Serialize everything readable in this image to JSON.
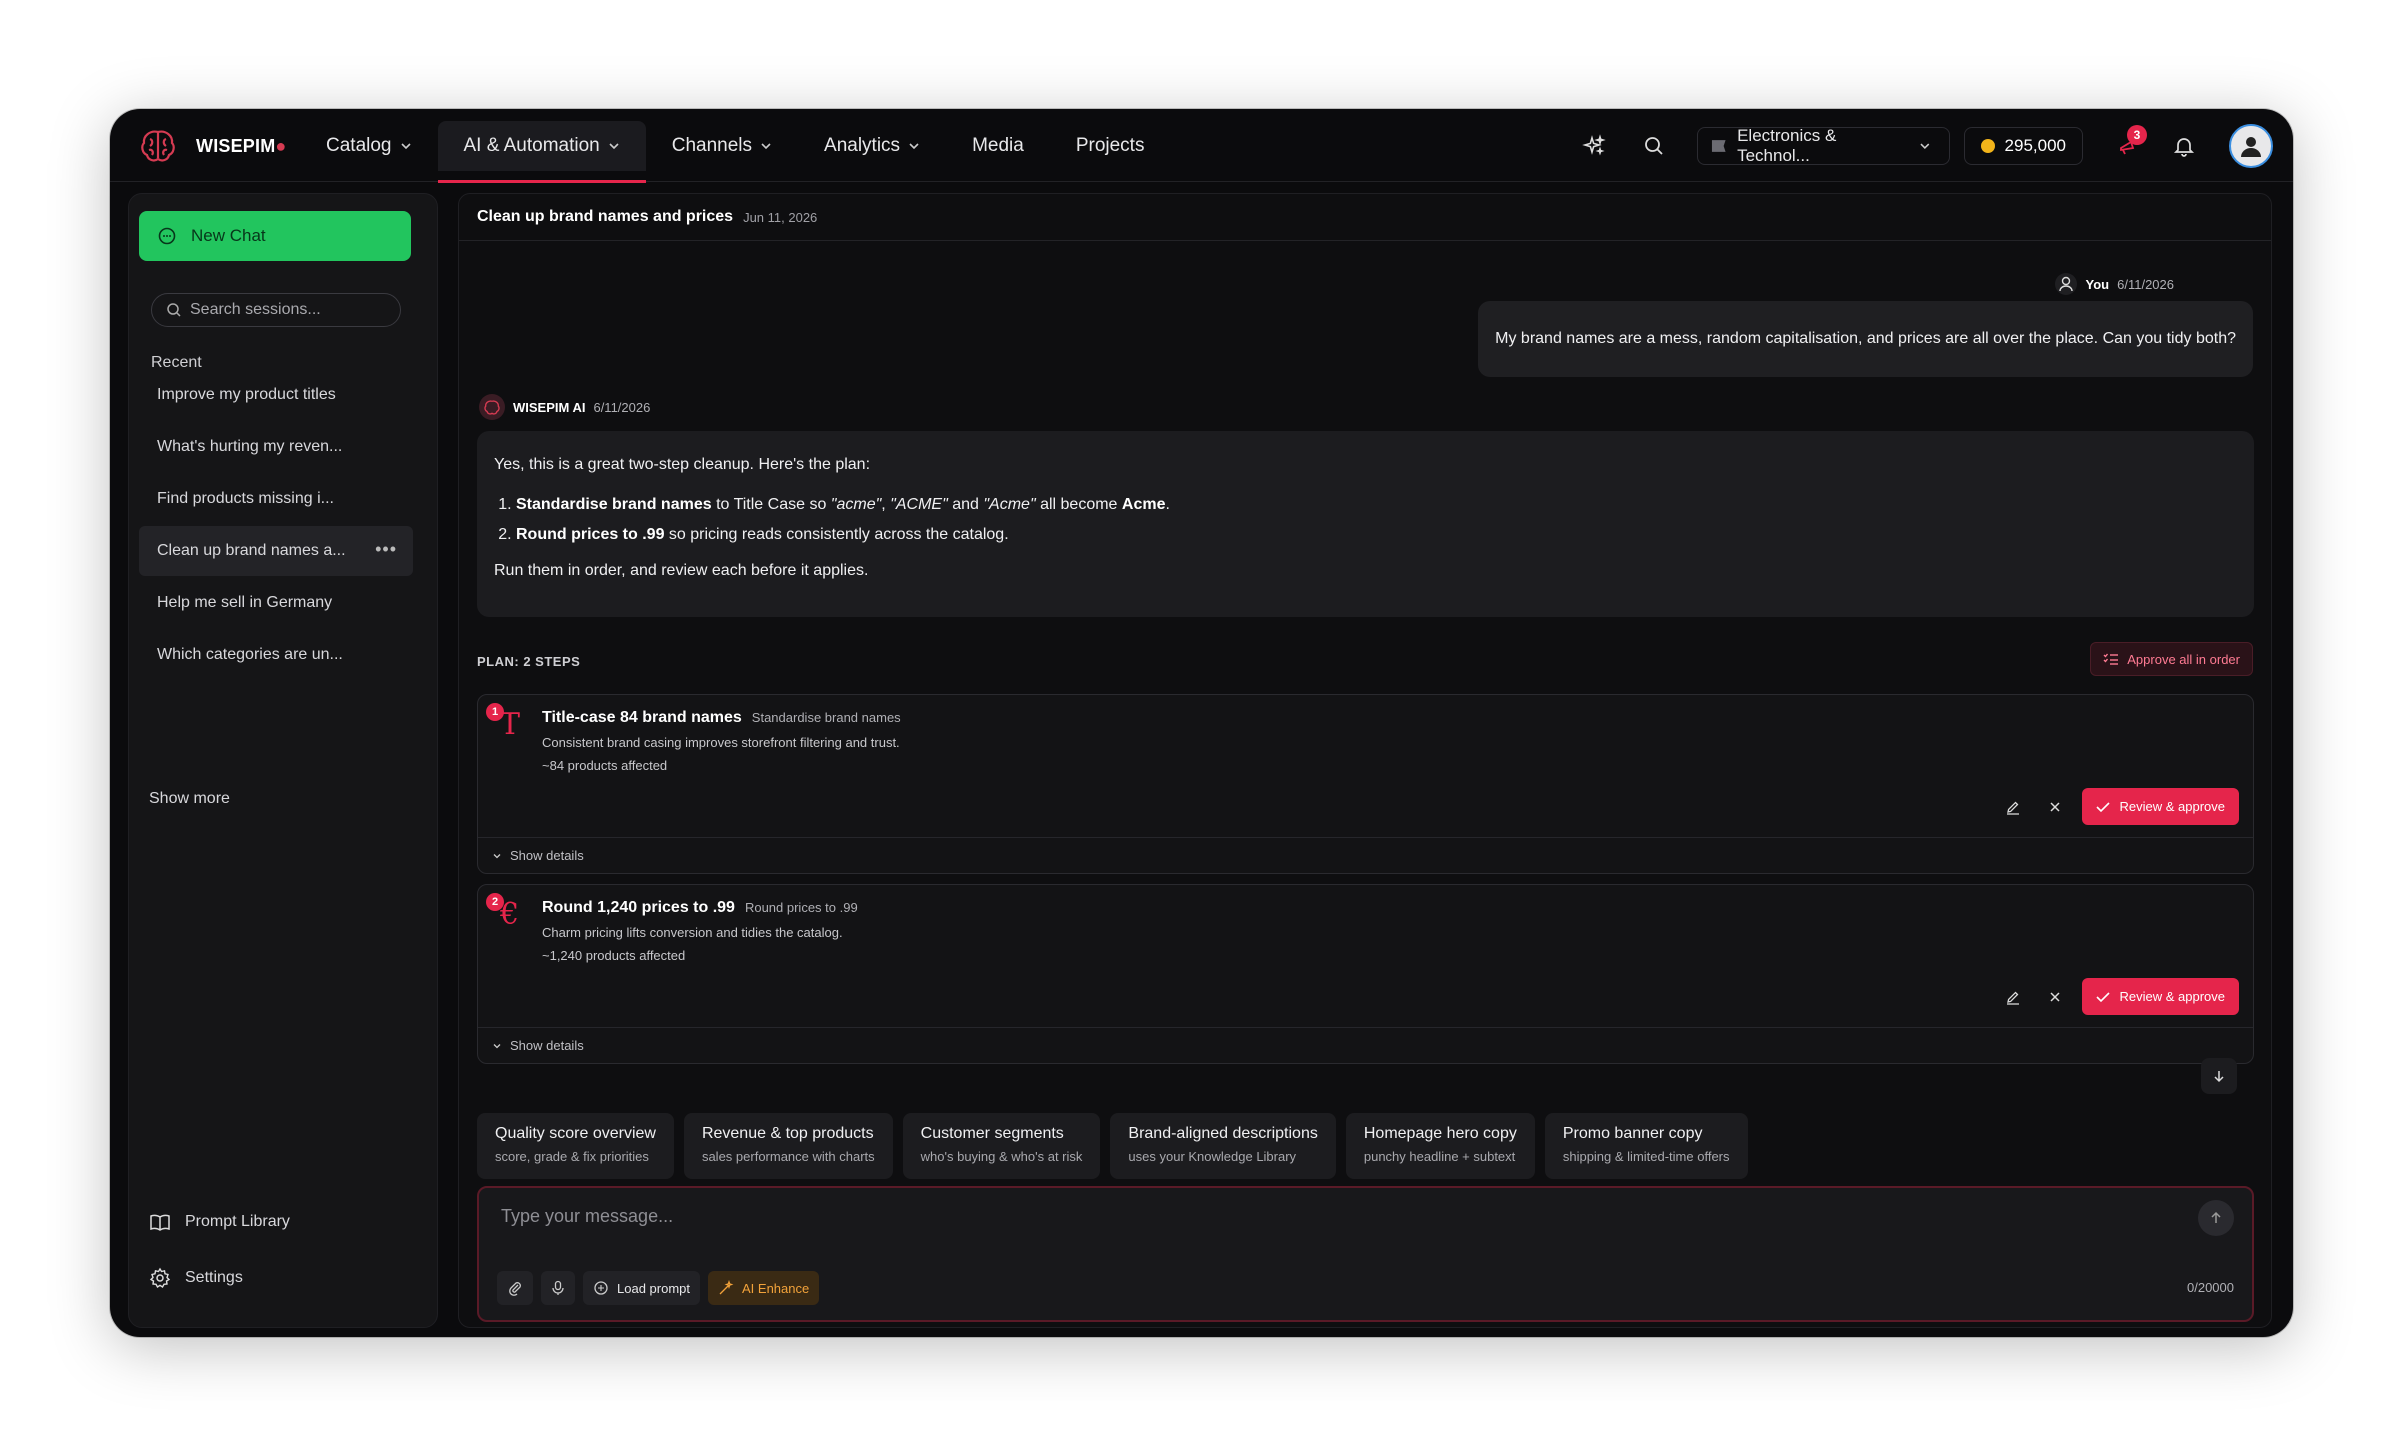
{
  "brand": {
    "name": "WISEPIM",
    "mark": "●"
  },
  "nav": {
    "items": [
      {
        "label": "Catalog",
        "has_menu": true,
        "active": false
      },
      {
        "label": "AI & Automation",
        "has_menu": true,
        "active": true
      },
      {
        "label": "Channels",
        "has_menu": true,
        "active": false
      },
      {
        "label": "Analytics",
        "has_menu": true,
        "active": false
      },
      {
        "label": "Media",
        "has_menu": false,
        "active": false
      },
      {
        "label": "Projects",
        "has_menu": false,
        "active": false
      }
    ],
    "store_label": "Electronics & Technol...",
    "credits": "295,000",
    "notification_count": "3"
  },
  "sidebar": {
    "new_chat_label": "New Chat",
    "search_placeholder": "Search sessions...",
    "recent_label": "Recent",
    "sessions": [
      "Improve my product titles",
      "What's hurting my reven...",
      "Find products missing i...",
      "Clean up brand names a...",
      "Help me sell in Germany",
      "Which categories are un..."
    ],
    "active_session_index": 3,
    "session_more_label": "•••",
    "show_more_label": "Show more",
    "prompt_library_label": "Prompt Library",
    "settings_label": "Settings"
  },
  "chat": {
    "title": "Clean up brand names and prices",
    "date": "Jun 11, 2026",
    "user": {
      "name": "You",
      "date": "6/11/2026",
      "message": "My brand names are a mess, random capitalisation, and prices are all over the place. Can you tidy both?"
    },
    "ai": {
      "name": "WISEPIM AI",
      "date": "6/11/2026",
      "intro": "Yes, this is a great two-step cleanup. Here's the plan:",
      "item1_bold": "Standardise brand names",
      "item1_text1": " to Title Case so ",
      "item1_q1": "\"acme\"",
      "item1_text2": ", ",
      "item1_q2": "\"ACME\"",
      "item1_text3": " and ",
      "item1_q3": "\"Acme\"",
      "item1_text4": " all become ",
      "item1_bold2": "Acme",
      "item1_text5": ".",
      "item2_bold": "Round prices to .99",
      "item2_text": " so pricing reads consistently across the catalog.",
      "outro": "Run them in order, and review each before it applies."
    }
  },
  "plan": {
    "label": "PLAN: 2 STEPS",
    "approve_all_label": "Approve all in order",
    "steps": [
      {
        "number": "1",
        "glyph": "T",
        "title": "Title-case 84 brand names",
        "subtitle": "Standardise brand names",
        "description": "Consistent brand casing improves storefront filtering and trust.",
        "affected": "~84 products affected",
        "review_label": "Review & approve",
        "details_label": "Show details"
      },
      {
        "number": "2",
        "glyph": "€",
        "title": "Round 1,240 prices to .99",
        "subtitle": "Round prices to .99",
        "description": "Charm pricing lifts conversion and tidies the catalog.",
        "affected": "~1,240 products affected",
        "review_label": "Review & approve",
        "details_label": "Show details"
      }
    ]
  },
  "suggestions": [
    {
      "title": "Quality score overview",
      "subtitle": "score, grade & fix priorities"
    },
    {
      "title": "Revenue & top products",
      "subtitle": "sales performance with charts"
    },
    {
      "title": "Customer segments",
      "subtitle": "who's buying & who's at risk"
    },
    {
      "title": "Brand-aligned descriptions",
      "subtitle": "uses your Knowledge Library"
    },
    {
      "title": "Homepage hero copy",
      "subtitle": "punchy headline + subtext"
    },
    {
      "title": "Promo banner copy",
      "subtitle": "shipping & limited-time offers"
    }
  ],
  "composer": {
    "placeholder": "Type your message...",
    "load_prompt_label": "Load prompt",
    "ai_enhance_label": "AI Enhance",
    "counter": "0/20000"
  },
  "colors": {
    "accent": "#e5254b",
    "new_chat": "#22c55e",
    "enhance": "#f2a23a"
  }
}
